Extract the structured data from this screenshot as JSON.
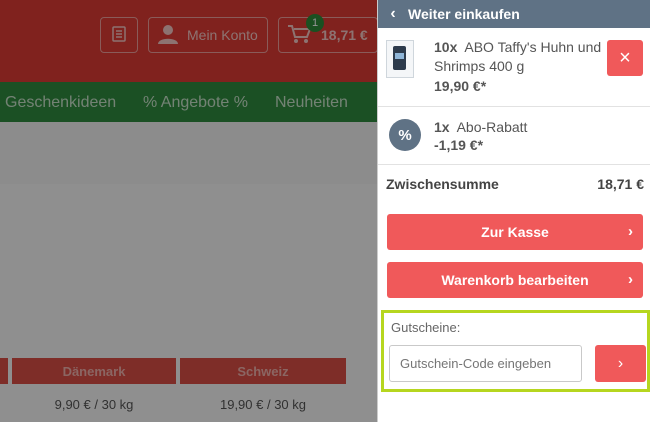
{
  "header": {
    "account_label": "Mein Konto",
    "cart_total": "18,71 €",
    "cart_count": "1"
  },
  "nav": {
    "items": [
      "Geschenkideen",
      "% Angebote %",
      "Neuheiten"
    ]
  },
  "shipping_table": {
    "headers": [
      "Dänemark",
      "Schweiz"
    ],
    "rows": [
      [
        "9,90 € / 30 kg",
        "19,90 € / 30 kg"
      ]
    ]
  },
  "cart": {
    "back_label": "Weiter einkaufen",
    "items": [
      {
        "qty": "10x",
        "name": "ABO Taffy's Huhn und Shrimps 400 g",
        "price": "19,90 €*"
      },
      {
        "qty": "1x",
        "name": "Abo-Rabatt",
        "price": "-1,19 €*"
      }
    ],
    "subtotal_label": "Zwischensumme",
    "subtotal_value": "18,71 €",
    "checkout_label": "Zur Kasse",
    "edit_label": "Warenkorb bearbeiten",
    "coupon_label": "Gutscheine:",
    "coupon_placeholder": "Gutschein-Code eingeben"
  },
  "colors": {
    "brand_red": "#dc3b35",
    "nav_green": "#2f8b3e",
    "button_red": "#f0595a",
    "panel_header": "#5f7285",
    "highlight": "#b6d61f"
  },
  "icons": [
    "notepad-icon",
    "user-icon",
    "cart-icon",
    "chevron-left-icon",
    "close-icon",
    "percent-icon",
    "chevron-right-icon"
  ]
}
